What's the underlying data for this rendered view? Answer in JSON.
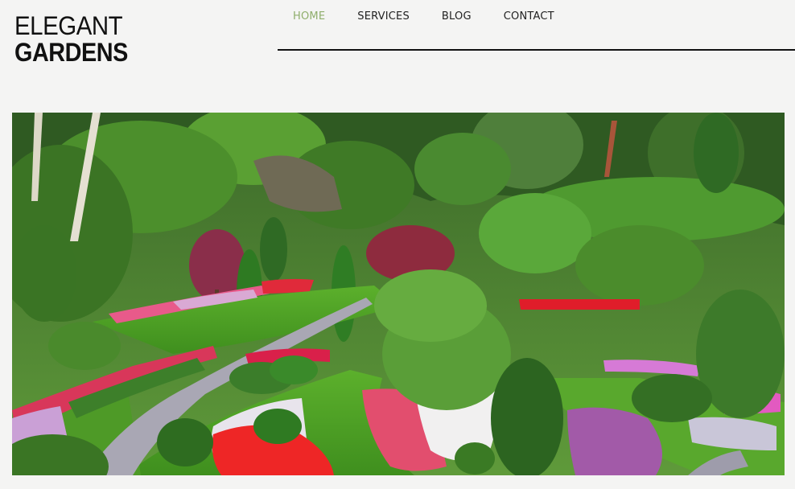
{
  "logo": {
    "line1": "ELEGANT",
    "line2": "GARDENS"
  },
  "nav": {
    "items": [
      {
        "label": "HOME",
        "active": true
      },
      {
        "label": "SERVICES",
        "active": false
      },
      {
        "label": "BLOG",
        "active": false
      },
      {
        "label": "CONTACT",
        "active": false
      }
    ]
  },
  "colors": {
    "accent": "#8fae6c",
    "text": "#222222",
    "background": "#f4f4f3"
  }
}
